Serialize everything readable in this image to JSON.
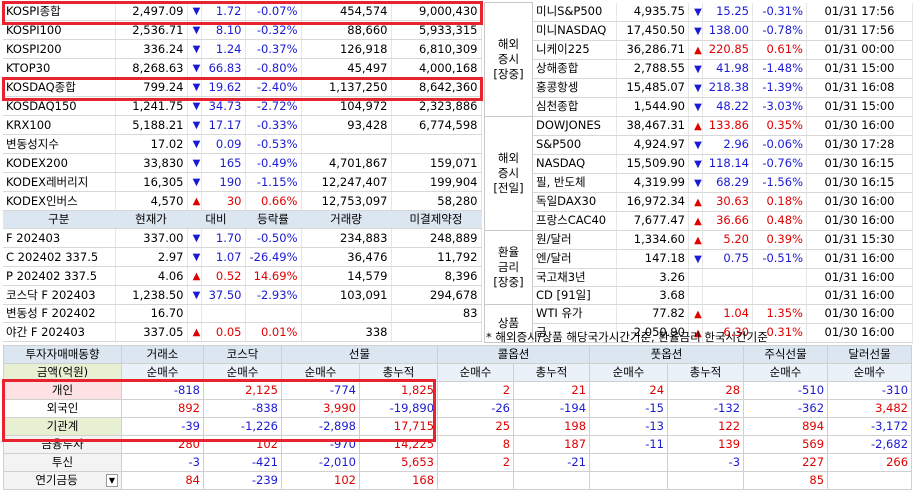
{
  "domestic": [
    {
      "name": "KOSPI종합",
      "price": "2,497.09",
      "dir": "dn",
      "change": "1.72",
      "rate": "-0.07%",
      "vol": "454,574",
      "amt": "9,000,430"
    },
    {
      "name": "KOSPI100",
      "price": "2,536.71",
      "dir": "dn",
      "change": "8.10",
      "rate": "-0.32%",
      "vol": "88,660",
      "amt": "5,933,315"
    },
    {
      "name": "KOSPI200",
      "price": "336.24",
      "dir": "dn",
      "change": "1.24",
      "rate": "-0.37%",
      "vol": "126,918",
      "amt": "6,810,309"
    },
    {
      "name": "KTOP30",
      "price": "8,268.63",
      "dir": "dn",
      "change": "66.83",
      "rate": "-0.80%",
      "vol": "45,497",
      "amt": "4,000,168"
    },
    {
      "name": "KOSDAQ종합",
      "price": "799.24",
      "dir": "dn",
      "change": "19.62",
      "rate": "-2.40%",
      "vol": "1,137,250",
      "amt": "8,642,360"
    },
    {
      "name": "KOSDAQ150",
      "price": "1,241.75",
      "dir": "dn",
      "change": "34.73",
      "rate": "-2.72%",
      "vol": "104,972",
      "amt": "2,323,886"
    },
    {
      "name": "KRX100",
      "price": "5,188.21",
      "dir": "dn",
      "change": "17.17",
      "rate": "-0.33%",
      "vol": "93,428",
      "amt": "6,774,598"
    },
    {
      "name": "변동성지수",
      "price": "17.02",
      "dir": "dn",
      "change": "0.09",
      "rate": "-0.53%",
      "vol": "",
      "amt": ""
    },
    {
      "name": "KODEX200",
      "price": "33,830",
      "dir": "dn",
      "change": "165",
      "rate": "-0.49%",
      "vol": "4,701,867",
      "amt": "159,071"
    },
    {
      "name": "KODEX레버리지",
      "price": "16,305",
      "dir": "dn",
      "change": "190",
      "rate": "-1.15%",
      "vol": "12,247,407",
      "amt": "199,904"
    },
    {
      "name": "KODEX인버스",
      "price": "4,570",
      "dir": "up",
      "change": "30",
      "rate": "0.66%",
      "vol": "12,753,097",
      "amt": "58,280"
    }
  ],
  "futures_header": {
    "c1": "구분",
    "c2": "현재가",
    "c3": "대비",
    "c4": "등락률",
    "c5": "거래량",
    "c6": "미결제약정"
  },
  "futures": [
    {
      "name": "F 202403",
      "price": "337.00",
      "dir": "dn",
      "change": "1.70",
      "rate": "-0.50%",
      "vol": "234,883",
      "oi": "248,889"
    },
    {
      "name": "C 202402 337.5",
      "price": "2.97",
      "dir": "dn",
      "change": "1.07",
      "rate": "-26.49%",
      "vol": "36,476",
      "oi": "11,792"
    },
    {
      "name": "P 202402 337.5",
      "price": "4.06",
      "dir": "up",
      "change": "0.52",
      "rate": "14.69%",
      "vol": "14,579",
      "oi": "8,396"
    },
    {
      "name": "코스닥 F 202403",
      "price": "1,238.50",
      "dir": "dn",
      "change": "37.50",
      "rate": "-2.93%",
      "vol": "103,091",
      "oi": "294,678"
    },
    {
      "name": "변동성 F 202402",
      "price": "16.70",
      "dir": "",
      "change": "",
      "rate": "",
      "vol": "",
      "oi": "83"
    },
    {
      "name": "야간  F 202403",
      "price": "337.05",
      "dir": "up",
      "change": "0.05",
      "rate": "0.01%",
      "vol": "338",
      "oi": ""
    }
  ],
  "overseas_groups": [
    {
      "label": "해외\n증시\n[장중]",
      "rows": [
        {
          "name": "미니S&P500",
          "price": "4,935.75",
          "dir": "dn",
          "change": "15.25",
          "rate": "-0.31%",
          "time": "01/31 17:56"
        },
        {
          "name": "미니NASDAQ",
          "price": "17,450.50",
          "dir": "dn",
          "change": "138.00",
          "rate": "-0.78%",
          "time": "01/31 17:56"
        },
        {
          "name": "니케이225",
          "price": "36,286.71",
          "dir": "up",
          "change": "220.85",
          "rate": "0.61%",
          "time": "01/31 00:00"
        },
        {
          "name": "상해종합",
          "price": "2,788.55",
          "dir": "dn",
          "change": "41.98",
          "rate": "-1.48%",
          "time": "01/31 15:00"
        },
        {
          "name": "홍콩항셍",
          "price": "15,485.07",
          "dir": "dn",
          "change": "218.38",
          "rate": "-1.39%",
          "time": "01/31 16:08"
        },
        {
          "name": "심천종합",
          "price": "1,544.90",
          "dir": "dn",
          "change": "48.22",
          "rate": "-3.03%",
          "time": "01/31 15:00"
        }
      ]
    },
    {
      "label": "해외\n증시\n[전일]",
      "rows": [
        {
          "name": "DOWJONES",
          "price": "38,467.31",
          "dir": "up",
          "change": "133.86",
          "rate": "0.35%",
          "time": "01/30 16:00"
        },
        {
          "name": "S&P500",
          "price": "4,924.97",
          "dir": "dn",
          "change": "2.96",
          "rate": "-0.06%",
          "time": "01/30 17:28"
        },
        {
          "name": "NASDAQ",
          "price": "15,509.90",
          "dir": "dn",
          "change": "118.14",
          "rate": "-0.76%",
          "time": "01/30 16:15"
        },
        {
          "name": "필, 반도체",
          "price": "4,319.99",
          "dir": "dn",
          "change": "68.29",
          "rate": "-1.56%",
          "time": "01/30 16:15"
        },
        {
          "name": "독일DAX30",
          "price": "16,972.34",
          "dir": "up",
          "change": "30.63",
          "rate": "0.18%",
          "time": "01/30 16:00"
        },
        {
          "name": "프랑스CAC40",
          "price": "7,677.47",
          "dir": "up",
          "change": "36.66",
          "rate": "0.48%",
          "time": "01/30 16:00"
        }
      ]
    },
    {
      "label": "환율\n금리\n[장중]",
      "rows": [
        {
          "name": "원/달러",
          "price": "1,334.60",
          "dir": "up",
          "change": "5.20",
          "rate": "0.39%",
          "time": "01/31 15:30"
        },
        {
          "name": "엔/달러",
          "price": "147.18",
          "dir": "dn",
          "change": "0.75",
          "rate": "-0.51%",
          "time": "01/31 16:00"
        },
        {
          "name": "국고채3년",
          "price": "3.26",
          "dir": "",
          "change": "",
          "rate": "",
          "time": "01/31 16:00"
        },
        {
          "name": "CD [91일]",
          "price": "3.68",
          "dir": "",
          "change": "",
          "rate": "",
          "time": "01/31 16:00"
        }
      ]
    },
    {
      "label": "상품",
      "rows": [
        {
          "name": "WTI 유가",
          "price": "77.82",
          "dir": "up",
          "change": "1.04",
          "rate": "1.35%",
          "time": "01/30 16:00"
        },
        {
          "name": "금",
          "price": "2,050.90",
          "dir": "up",
          "change": "6.30",
          "rate": "0.31%",
          "time": "01/30 16:00"
        }
      ]
    }
  ],
  "note": "* 해외증시/상품 해당국가시간기준, 환율금리 한국시간기준",
  "investor": {
    "title": "투자자매매동향",
    "groups": [
      "거래소",
      "코스닥",
      "선물",
      "콜옵션",
      "풋옵션",
      "주식선물",
      "달러선물"
    ],
    "unit_label": "금액(억원)",
    "sub": [
      "순매수",
      "순매수",
      "순매수",
      "총누적",
      "순매수",
      "총누적",
      "순매수",
      "총누적",
      "순매수",
      "순매수"
    ],
    "rows": [
      {
        "name": "개인",
        "style": "pink",
        "v": [
          "-818",
          "2,125",
          "-774",
          "1,825",
          "2",
          "21",
          "24",
          "28",
          "-510",
          "-310"
        ]
      },
      {
        "name": "외국인",
        "style": "white",
        "v": [
          "892",
          "-838",
          "3,990",
          "-19,890",
          "-26",
          "-194",
          "-15",
          "-132",
          "-362",
          "3,482"
        ]
      },
      {
        "name": "기관계",
        "style": "green",
        "v": [
          "-39",
          "-1,226",
          "-2,898",
          "17,715",
          "25",
          "198",
          "-13",
          "122",
          "894",
          "-3,172"
        ]
      },
      {
        "name": "금융투자",
        "style": "gray",
        "v": [
          "280",
          "102",
          "-970",
          "14,225",
          "8",
          "187",
          "-11",
          "139",
          "569",
          "-2,682"
        ]
      },
      {
        "name": "투신",
        "style": "gray",
        "v": [
          "-3",
          "-421",
          "-2,010",
          "5,653",
          "2",
          "-21",
          "",
          "-3",
          "227",
          "266"
        ]
      },
      {
        "name": "연기금등",
        "style": "gray",
        "v": [
          "84",
          "-239",
          "102",
          "168",
          "",
          "",
          "",
          "",
          "85",
          ""
        ]
      }
    ]
  },
  "colors": {
    "up": "#e00000",
    "down": "#1a1ad4",
    "highlight": "#e8222e",
    "header": "#dce6f1"
  }
}
